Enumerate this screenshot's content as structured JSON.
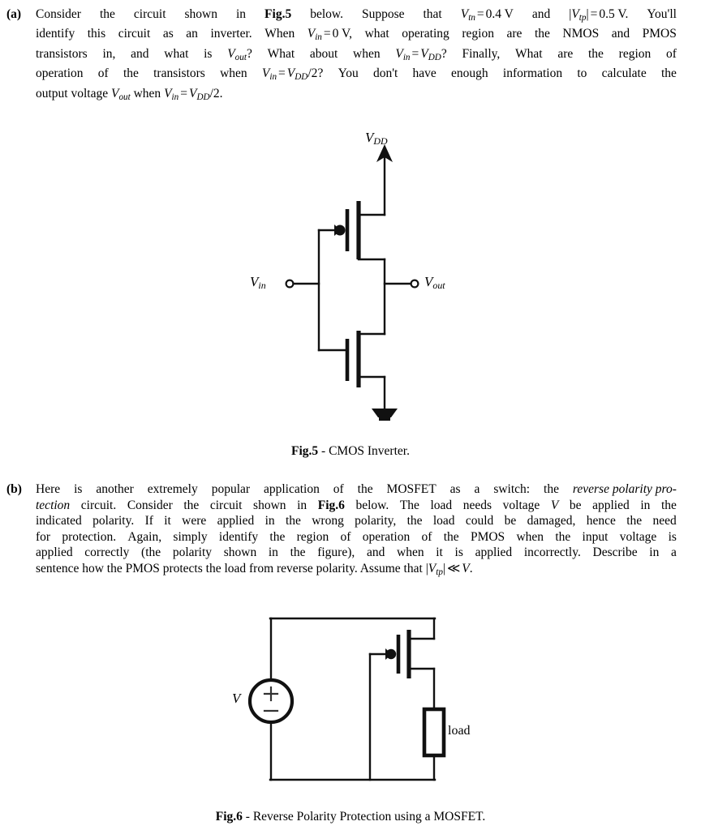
{
  "document": {
    "type": "homework-problem-sheet",
    "topic": "MOSFET circuits"
  },
  "parts": [
    {
      "label": "(a)",
      "lines": [
        [
          "Consider",
          "the",
          "circuit",
          "shown",
          "in",
          "Fig.5",
          "below.",
          "Suppose",
          "that",
          "Vtn = 0.4 V",
          "and",
          "|Vtp| = 0.5 V.",
          "You'll"
        ],
        [
          "identify this circuit as an inverter. When Vin = 0 V, what operating region are the NMOS and PMOS"
        ],
        [
          "transistors in, and what is Vout?  What about when Vin = VDD?  Finally, What are the region of"
        ],
        [
          "operation of the transistors when Vin = VDD/2? You don't have enough information to calculate the"
        ],
        [
          "output voltage Vout when Vin = VDD/2."
        ]
      ],
      "plain_text": "Consider the circuit shown in Fig.5 below. Suppose that Vtn = 0.4 V and |Vtp| = 0.5 V. You'll identify this circuit as an inverter. When Vin = 0 V, what operating region are the NMOS and PMOS transistors in, and what is Vout? What about when Vin = VDD? Finally, What are the region of operation of the transistors when Vin = VDD/2? You don't have enough information to calculate the output voltage Vout when Vin = VDD/2."
    },
    {
      "label": "(b)",
      "plain_text": "Here is another extremely popular application of the MOSFET as a switch: the reverse polarity protection circuit. Consider the circuit shown in Fig.6 below. The load needs voltage V be applied in the indicated polarity. If it were applied in the wrong polarity, the load could be damaged, hence the need for protection. Again, simply identify the region of operation of the PMOS when the input voltage is applied correctly (the polarity shown in the figure), and when it is applied incorrectly. Describe in a sentence how the PMOS protects the load from reverse polarity. Assume that |Vtp| << V."
    }
  ],
  "figure5": {
    "caption_bold": "Fig.5",
    "caption_rest": " - CMOS Inverter.",
    "labels": {
      "supply": "VDD",
      "supply_base": "V",
      "supply_sub": "DD",
      "input_base": "V",
      "input_sub": "in",
      "output_base": "V",
      "output_sub": "out"
    },
    "components": [
      "pmos-transistor",
      "nmos-transistor",
      "vdd-supply-arrow",
      "ground-symbol",
      "input-terminal",
      "output-terminal"
    ]
  },
  "figure6": {
    "caption_bold": "Fig.6",
    "caption_rest": " - Reverse Polarity Protection using a MOSFET.",
    "labels": {
      "source": "V",
      "source_plus": "+",
      "source_minus": "−",
      "load": "load"
    },
    "components": [
      "voltage-source",
      "pmos-transistor",
      "load-resistor",
      "wires"
    ]
  },
  "colors": {
    "ink": "#111111",
    "page": "#ffffff"
  }
}
